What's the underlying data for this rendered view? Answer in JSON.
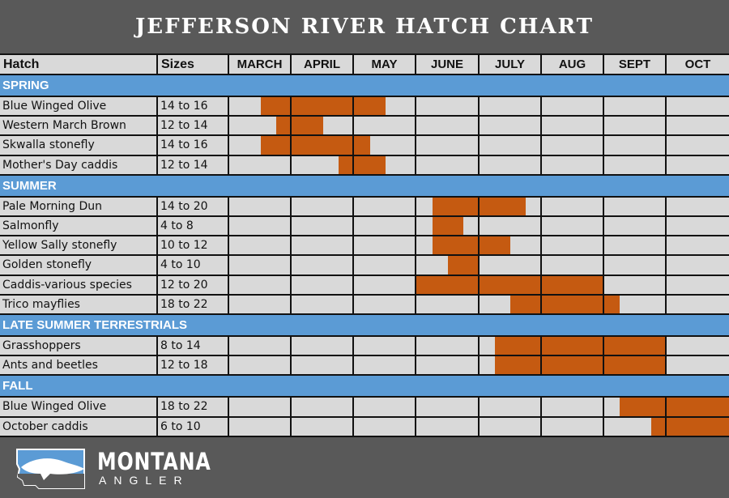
{
  "title": "JEFFERSON RIVER HATCH CHART",
  "chart_data": {
    "type": "table",
    "title": "JEFFERSON RIVER HATCH CHART",
    "columns": [
      "Hatch",
      "Sizes",
      "MARCH",
      "APRIL",
      "MAY",
      "JUNE",
      "JULY",
      "AUG",
      "SEPT",
      "OCT"
    ],
    "months": [
      "MARCH",
      "APRIL",
      "MAY",
      "JUNE",
      "JULY",
      "AUG",
      "SEPT",
      "OCT"
    ],
    "bar_unit": "months from start of MARCH (0 = March 1, 8 = end of October)",
    "sections": [
      {
        "name": "SPRING",
        "rows": [
          {
            "hatch": "Blue Winged Olive",
            "sizes": "14 to 16",
            "start": 0.5,
            "end": 2.5
          },
          {
            "hatch": "Western March Brown",
            "sizes": "12 to 14",
            "start": 0.75,
            "end": 1.5
          },
          {
            "hatch": "Skwalla stonefly",
            "sizes": "14 to 16",
            "start": 0.5,
            "end": 2.25
          },
          {
            "hatch": "Mother's Day caddis",
            "sizes": "12 to 14",
            "start": 1.75,
            "end": 2.5
          }
        ]
      },
      {
        "name": "SUMMER",
        "rows": [
          {
            "hatch": "Pale Morning Dun",
            "sizes": "14 to 20",
            "start": 3.25,
            "end": 4.75
          },
          {
            "hatch": "Salmonfly",
            "sizes": "4 to 8",
            "start": 3.25,
            "end": 3.75
          },
          {
            "hatch": "Yellow Sally stonefly",
            "sizes": "10 to 12",
            "start": 3.25,
            "end": 4.5
          },
          {
            "hatch": "Golden stonefly",
            "sizes": "4 to 10",
            "start": 3.5,
            "end": 4.0
          },
          {
            "hatch": "Caddis-various species",
            "sizes": "12 to 20",
            "start": 3.0,
            "end": 6.0
          },
          {
            "hatch": "Trico mayflies",
            "sizes": "18 to 22",
            "start": 4.5,
            "end": 6.25
          }
        ]
      },
      {
        "name": "LATE SUMMER TERRESTRIALS",
        "rows": [
          {
            "hatch": "Grasshoppers",
            "sizes": "8 to 14",
            "start": 4.25,
            "end": 7.0
          },
          {
            "hatch": "Ants and beetles",
            "sizes": "12 to 18",
            "start": 4.25,
            "end": 7.0
          }
        ]
      },
      {
        "name": "FALL",
        "rows": [
          {
            "hatch": "Blue Winged Olive",
            "sizes": "18 to 22",
            "start": 6.25,
            "end": 8.0
          },
          {
            "hatch": "October caddis",
            "sizes": "6 to 10",
            "start": 6.75,
            "end": 8.0
          }
        ]
      }
    ]
  },
  "colors": {
    "background": "#595959",
    "section": "#5b9bd5",
    "cell": "#d9d9d9",
    "bar": "#c55a11"
  },
  "brand": {
    "line1": "MONTANA",
    "line2": "ANGLER",
    "logo_icon": "montana-fish-logo"
  }
}
